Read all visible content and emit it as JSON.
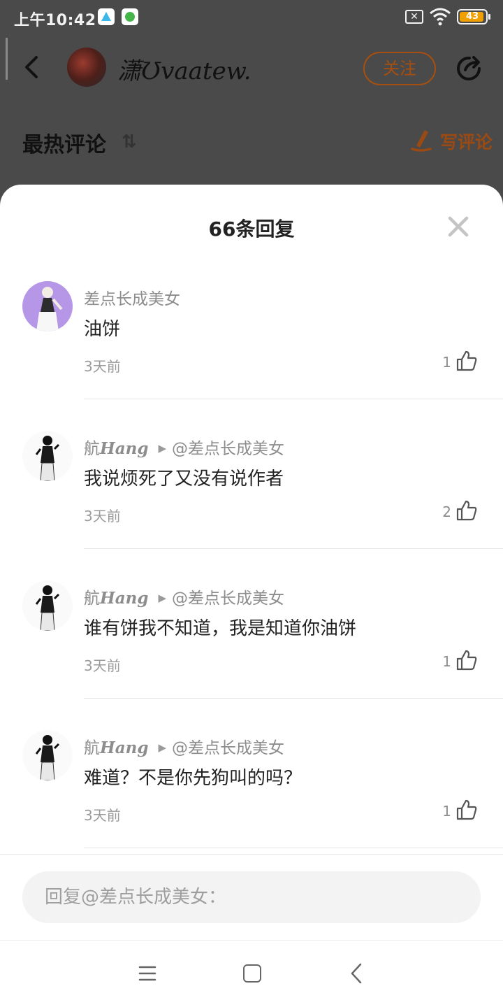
{
  "status_bar": {
    "time": "上午10:42",
    "sim_icon": "sim-x-icon",
    "wifi_icon": "wifi-icon",
    "battery": "43"
  },
  "header": {
    "user_name": "潇Ʊvaatew.",
    "follow_label": "关注",
    "hot_comments_title": "最热评论",
    "write_comment_label": "写评论"
  },
  "sheet": {
    "title": "66条回复",
    "replies": [
      {
        "author": "差点长成美女",
        "author_suffix": "",
        "mention": "",
        "text": "油饼",
        "time": "3天前",
        "likes": "1"
      },
      {
        "author": "航",
        "author_suffix": "Hang",
        "mention": "@差点长成美女",
        "text": "我说烦死了又没有说作者",
        "time": "3天前",
        "likes": "2"
      },
      {
        "author": "航",
        "author_suffix": "Hang",
        "mention": "@差点长成美女",
        "text": "谁有饼我不知道，我是知道你油饼",
        "time": "3天前",
        "likes": "1"
      },
      {
        "author": "航",
        "author_suffix": "Hang",
        "mention": "@差点长成美女",
        "text": "难道？不是你先狗叫的吗？",
        "time": "3天前",
        "likes": "1"
      }
    ]
  },
  "reply_input": {
    "placeholder": "回复@差点长成美女："
  },
  "colors": {
    "accent_orange": "#a64f11",
    "dim_overlay": "#4a4a4a",
    "text_gray": "#8d8d8d"
  }
}
